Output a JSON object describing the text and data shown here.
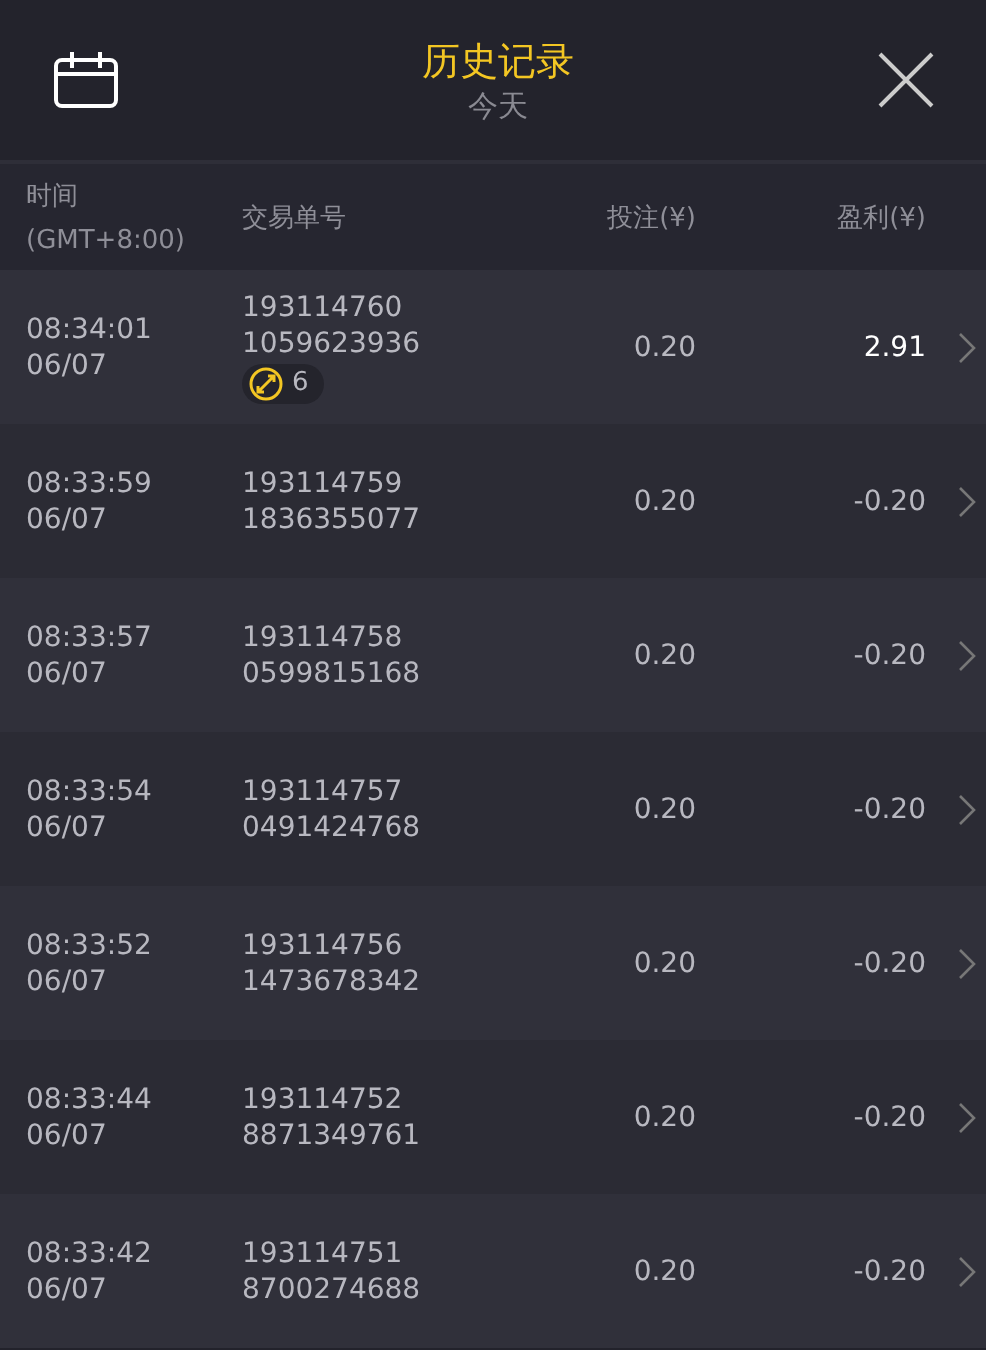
{
  "header": {
    "title": "历史记录",
    "subtitle": "今天"
  },
  "columns": {
    "time": [
      "时间",
      "(GMT+8:00)"
    ],
    "order": "交易单号",
    "bet": "投注(¥)",
    "profit": "盈利(¥)"
  },
  "rows": [
    {
      "time": "08:34:01",
      "date": "06/07",
      "order": "193114760",
      "ticket": "1059623936",
      "badge": "6",
      "bet": "0.20",
      "profit": "2.91",
      "win": true
    },
    {
      "time": "08:33:59",
      "date": "06/07",
      "order": "193114759",
      "ticket": "1836355077",
      "bet": "0.20",
      "profit": "-0.20",
      "win": false
    },
    {
      "time": "08:33:57",
      "date": "06/07",
      "order": "193114758",
      "ticket": "0599815168",
      "bet": "0.20",
      "profit": "-0.20",
      "win": false
    },
    {
      "time": "08:33:54",
      "date": "06/07",
      "order": "193114757",
      "ticket": "0491424768",
      "bet": "0.20",
      "profit": "-0.20",
      "win": false
    },
    {
      "time": "08:33:52",
      "date": "06/07",
      "order": "193114756",
      "ticket": "1473678342",
      "bet": "0.20",
      "profit": "-0.20",
      "win": false
    },
    {
      "time": "08:33:44",
      "date": "06/07",
      "order": "193114752",
      "ticket": "8871349761",
      "bet": "0.20",
      "profit": "-0.20",
      "win": false
    },
    {
      "time": "08:33:42",
      "date": "06/07",
      "order": "193114751",
      "ticket": "8700274688",
      "bet": "0.20",
      "profit": "-0.20",
      "win": false
    }
  ]
}
